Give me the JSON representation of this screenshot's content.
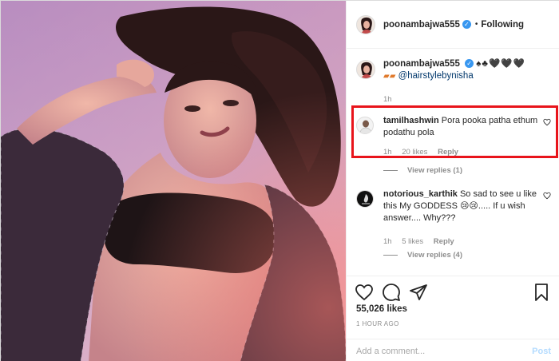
{
  "post": {
    "author": "poonambajwa555",
    "follow_dot": "•",
    "follow_status": "Following",
    "caption": {
      "username": "poonambajwa555",
      "suits": "♠♣🖤🖤🖤",
      "mention": "@hairstylebynisha",
      "time": "1h"
    },
    "comments": [
      {
        "username": "tamilhashwin",
        "text": "Pora pooka patha ethum podathu pola",
        "time": "1h",
        "likes": "20 likes",
        "reply": "Reply",
        "view_replies": "View replies (1)"
      },
      {
        "username": "notorious_karthik",
        "text": "So sad to see u like this My GODDESS 😢😢..... If u wish answer.... Why???",
        "time": "1h",
        "likes": "5 likes",
        "reply": "Reply",
        "view_replies": "View replies (4)"
      }
    ],
    "likes_count": "55,026 likes",
    "time_ago": "1 HOUR AGO",
    "add_comment_placeholder": "Add a comment...",
    "post_button": "Post"
  },
  "icons": {
    "like": "heart-icon",
    "comment": "comment-icon",
    "share": "share-icon",
    "save": "bookmark-icon",
    "verified": "verified-badge-icon"
  },
  "colors": {
    "highlight": "#e8141b",
    "verified": "#3897f0",
    "mention": "#00376b",
    "post_button": "#b3dbff",
    "muted": "#8e8e8e"
  }
}
